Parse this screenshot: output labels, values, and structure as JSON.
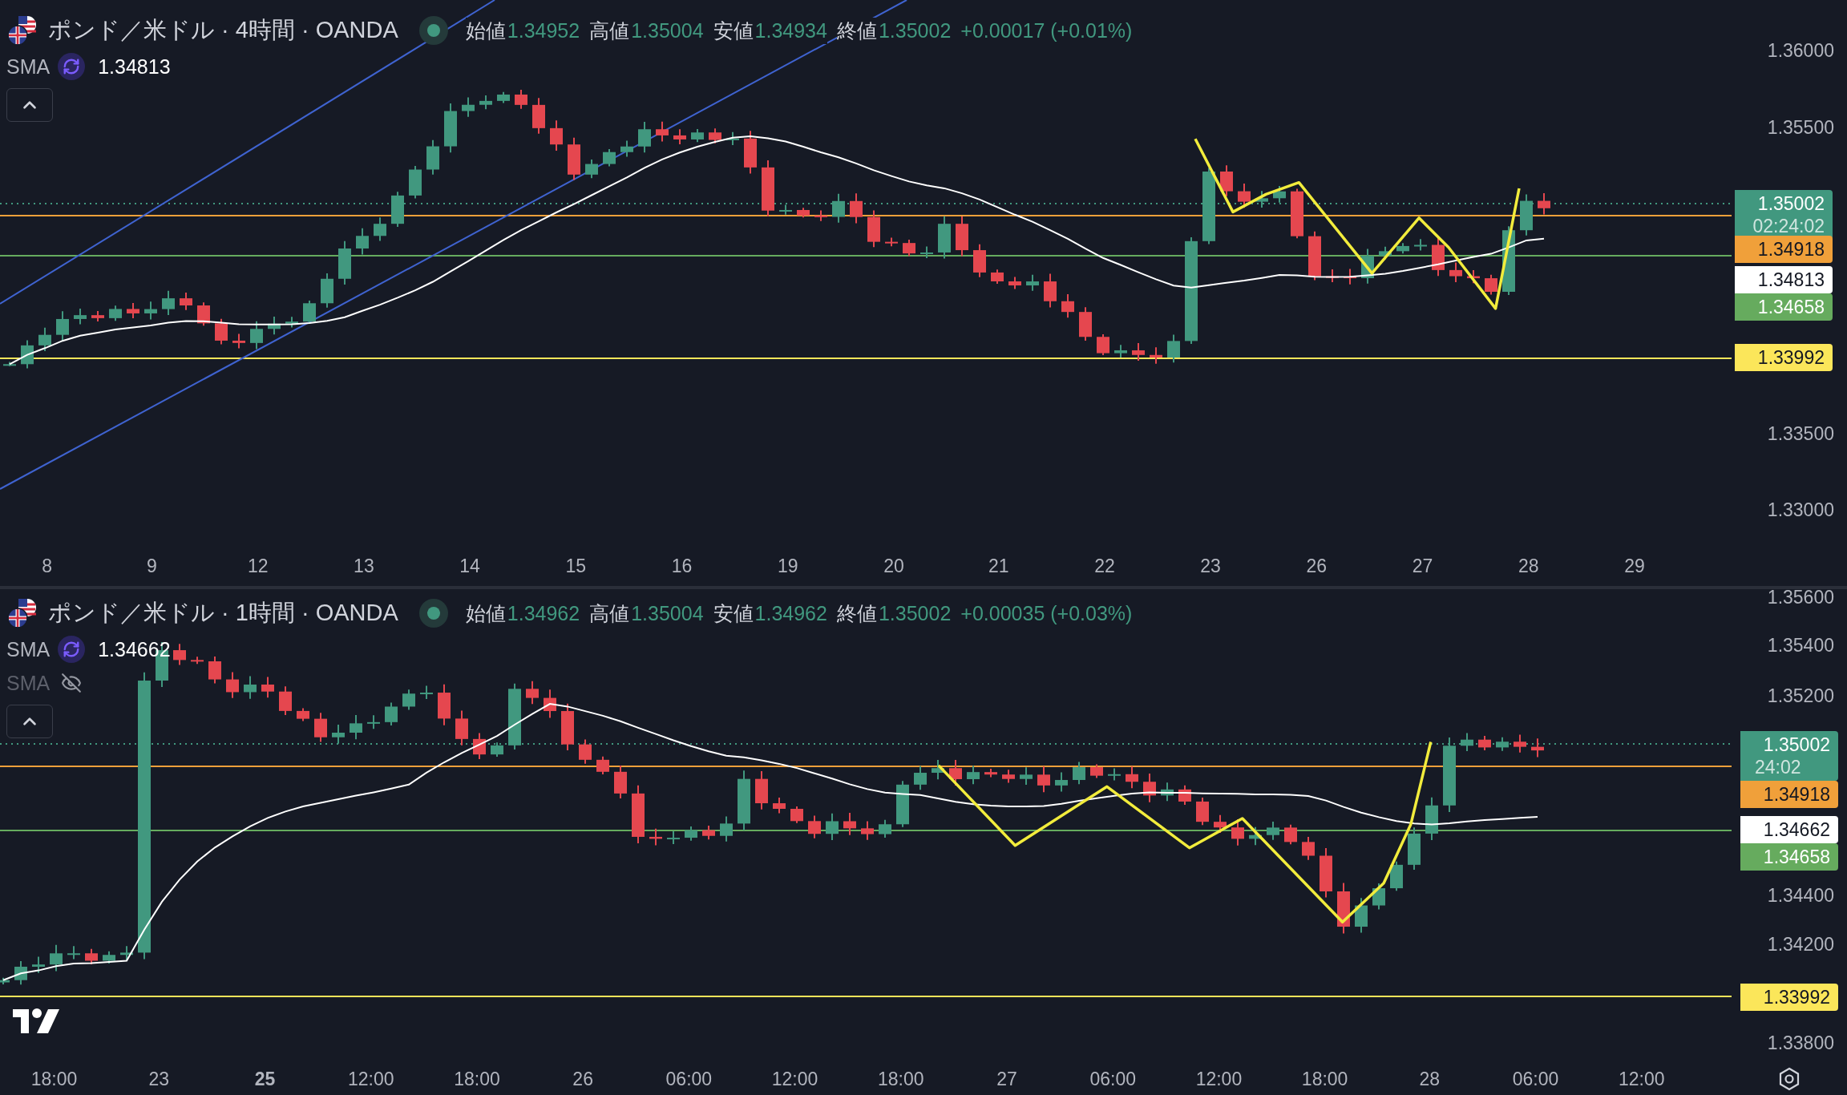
{
  "panes": [
    {
      "symbol": "ポンド／米ドル · 4時間 · OANDA",
      "ohlc": [
        {
          "label": "始値",
          "value": "1.34952"
        },
        {
          "label": "高値",
          "value": "1.35004"
        },
        {
          "label": "安値",
          "value": "1.34934"
        },
        {
          "label": "終値",
          "value": "1.35002"
        }
      ],
      "change": "+0.00017 (+0.01%)",
      "indicators": [
        {
          "name": "SMA",
          "visible": true,
          "value": "1.34813"
        }
      ],
      "price_axis": [
        "1.36000",
        "1.35500",
        "1.33500",
        "1.33000"
      ],
      "price_labels": [
        {
          "value": "1.35002",
          "countdown": "02:24:02",
          "color": "#41987f"
        },
        {
          "value": "1.34918",
          "color": "#f0a03a"
        },
        {
          "value": "1.34813",
          "color": "#ffffff"
        },
        {
          "value": "1.34658",
          "color": "#66ab5e"
        },
        {
          "value": "1.33992",
          "color": "#fbe65a"
        }
      ],
      "time_axis": [
        {
          "label": "8",
          "bold": false
        },
        {
          "label": "9",
          "bold": false
        },
        {
          "label": "12",
          "bold": false
        },
        {
          "label": "13",
          "bold": false
        },
        {
          "label": "14",
          "bold": false
        },
        {
          "label": "15",
          "bold": false
        },
        {
          "label": "16",
          "bold": false
        },
        {
          "label": "19",
          "bold": false
        },
        {
          "label": "20",
          "bold": false
        },
        {
          "label": "21",
          "bold": false
        },
        {
          "label": "22",
          "bold": false
        },
        {
          "label": "23",
          "bold": false
        },
        {
          "label": "26",
          "bold": false
        },
        {
          "label": "27",
          "bold": false
        },
        {
          "label": "28",
          "bold": false
        },
        {
          "label": "29",
          "bold": false
        }
      ]
    },
    {
      "symbol": "ポンド／米ドル · 1時間 · OANDA",
      "ohlc": [
        {
          "label": "始値",
          "value": "1.34962"
        },
        {
          "label": "高値",
          "value": "1.35004"
        },
        {
          "label": "安値",
          "value": "1.34962"
        },
        {
          "label": "終値",
          "value": "1.35002"
        }
      ],
      "change": "+0.00035 (+0.03%)",
      "indicators": [
        {
          "name": "SMA",
          "visible": true,
          "value": "1.34662"
        },
        {
          "name": "SMA",
          "visible": false
        }
      ],
      "price_axis": [
        "1.35600",
        "1.35400",
        "1.35200",
        "1.34400",
        "1.34200",
        "1.33800"
      ],
      "price_labels": [
        {
          "value": "1.35002",
          "countdown": "24:02",
          "color": "#41987f"
        },
        {
          "value": "1.34918",
          "color": "#f0a03a"
        },
        {
          "value": "1.34662",
          "color": "#ffffff"
        },
        {
          "value": "1.34658",
          "color": "#66ab5e"
        },
        {
          "value": "1.33992",
          "color": "#fbe65a"
        }
      ],
      "time_axis": [
        {
          "label": "18:00",
          "bold": false
        },
        {
          "label": "23",
          "bold": false
        },
        {
          "label": "25",
          "bold": true
        },
        {
          "label": "12:00",
          "bold": false
        },
        {
          "label": "18:00",
          "bold": false
        },
        {
          "label": "26",
          "bold": false
        },
        {
          "label": "06:00",
          "bold": false
        },
        {
          "label": "12:00",
          "bold": false
        },
        {
          "label": "18:00",
          "bold": false
        },
        {
          "label": "27",
          "bold": false
        },
        {
          "label": "06:00",
          "bold": false
        },
        {
          "label": "12:00",
          "bold": false
        },
        {
          "label": "18:00",
          "bold": false
        },
        {
          "label": "28",
          "bold": false
        },
        {
          "label": "06:00",
          "bold": false
        },
        {
          "label": "12:00",
          "bold": false
        }
      ]
    }
  ]
}
